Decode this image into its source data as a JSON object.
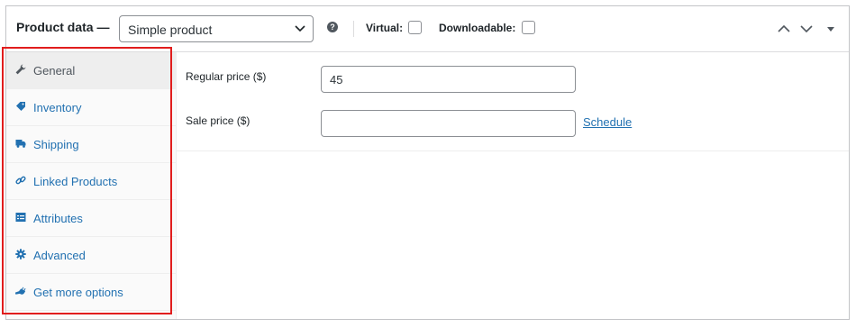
{
  "header": {
    "title": "Product data —",
    "product_type": "Simple product",
    "virtual_label": "Virtual:",
    "downloadable_label": "Downloadable:"
  },
  "tabs": [
    {
      "label": "General",
      "icon": "wrench-icon",
      "active": true
    },
    {
      "label": "Inventory",
      "icon": "tag-icon",
      "active": false
    },
    {
      "label": "Shipping",
      "icon": "truck-icon",
      "active": false
    },
    {
      "label": "Linked Products",
      "icon": "link-icon",
      "active": false
    },
    {
      "label": "Attributes",
      "icon": "list-icon",
      "active": false
    },
    {
      "label": "Advanced",
      "icon": "gear-icon",
      "active": false
    },
    {
      "label": "Get more options",
      "icon": "plug-icon",
      "active": false
    }
  ],
  "general": {
    "regular_price_label": "Regular price ($)",
    "regular_price_value": "45",
    "sale_price_label": "Sale price ($)",
    "sale_price_value": "",
    "schedule_link": "Schedule"
  },
  "colors": {
    "accent": "#2271b1",
    "highlight": "#e11d1d"
  }
}
